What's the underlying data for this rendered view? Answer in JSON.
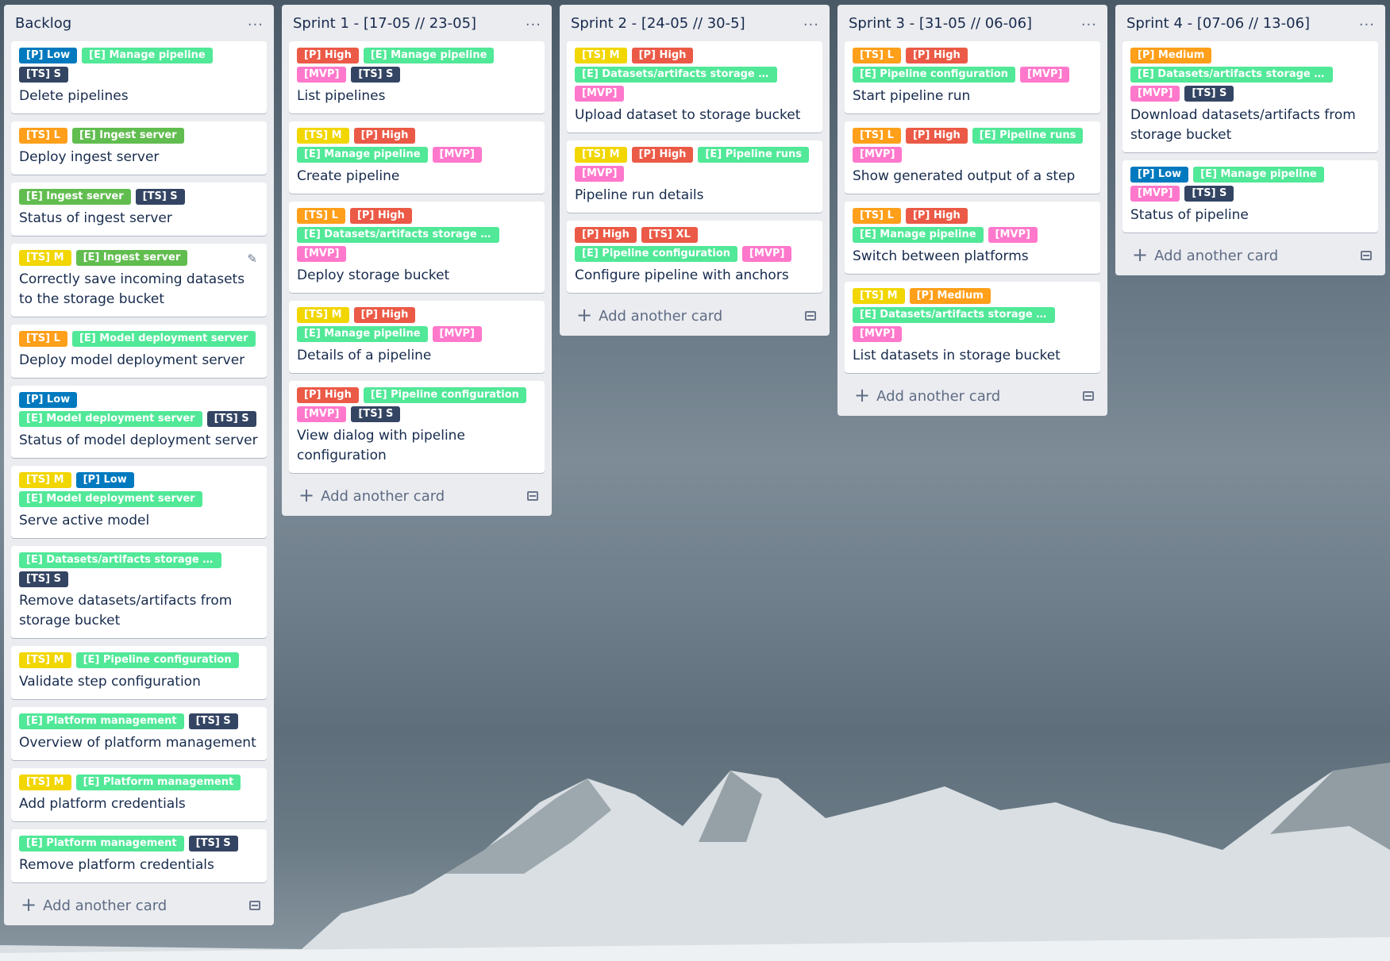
{
  "menu_icon": "...",
  "label_colors": {
    "blue": "#0079bf",
    "green": "#61bd4f",
    "mint": "#51e898",
    "dark": "#344563",
    "yellow": "#f2d600",
    "orange": "#ff9f1a",
    "red": "#eb5a46",
    "pink": "#ff78cb"
  },
  "add_card_label": "Add another card",
  "lists": [
    {
      "title": "Backlog",
      "cards": [
        {
          "labels": [
            {
              "text": "[P] Low",
              "color": "blue"
            },
            {
              "text": "[E] Manage pipeline",
              "color": "mint"
            },
            {
              "text": "[TS] S",
              "color": "dark"
            }
          ],
          "title": "Delete pipelines"
        },
        {
          "labels": [
            {
              "text": "[TS] L",
              "color": "orange"
            },
            {
              "text": "[E] Ingest server",
              "color": "green"
            }
          ],
          "title": "Deploy ingest server"
        },
        {
          "labels": [
            {
              "text": "[E] Ingest server",
              "color": "green"
            },
            {
              "text": "[TS] S",
              "color": "dark"
            }
          ],
          "title": "Status of ingest server"
        },
        {
          "labels": [
            {
              "text": "[TS] M",
              "color": "yellow"
            },
            {
              "text": "[E] Ingest server",
              "color": "green"
            }
          ],
          "title": "Correctly save incoming datasets to the storage bucket",
          "edit": true
        },
        {
          "labels": [
            {
              "text": "[TS] L",
              "color": "orange"
            },
            {
              "text": "[E] Model deployment server",
              "color": "mint"
            }
          ],
          "title": "Deploy model deployment server"
        },
        {
          "labels": [
            {
              "text": "[P] Low",
              "color": "blue"
            },
            {
              "text": "[E] Model deployment server",
              "color": "mint"
            },
            {
              "text": "[TS] S",
              "color": "dark"
            }
          ],
          "title": "Status of model deployment server"
        },
        {
          "labels": [
            {
              "text": "[TS] M",
              "color": "yellow"
            },
            {
              "text": "[P] Low",
              "color": "blue"
            },
            {
              "text": "[E] Model deployment server",
              "color": "mint"
            }
          ],
          "title": "Serve active model"
        },
        {
          "labels": [
            {
              "text": "[E] Datasets/artifacts storage bu...",
              "color": "mint"
            },
            {
              "text": "[TS] S",
              "color": "dark"
            }
          ],
          "title": "Remove datasets/artifacts from storage bucket"
        },
        {
          "labels": [
            {
              "text": "[TS] M",
              "color": "yellow"
            },
            {
              "text": "[E] Pipeline configuration",
              "color": "mint"
            }
          ],
          "title": "Validate step configuration"
        },
        {
          "labels": [
            {
              "text": "[E] Platform management",
              "color": "mint"
            },
            {
              "text": "[TS] S",
              "color": "dark"
            }
          ],
          "title": "Overview of platform management"
        },
        {
          "labels": [
            {
              "text": "[TS] M",
              "color": "yellow"
            },
            {
              "text": "[E] Platform management",
              "color": "mint"
            }
          ],
          "title": "Add platform credentials"
        },
        {
          "labels": [
            {
              "text": "[E] Platform management",
              "color": "mint"
            },
            {
              "text": "[TS] S",
              "color": "dark"
            }
          ],
          "title": "Remove platform credentials"
        }
      ]
    },
    {
      "title": "Sprint 1 - [17-05 // 23-05]",
      "cards": [
        {
          "labels": [
            {
              "text": "[P] High",
              "color": "red"
            },
            {
              "text": "[E] Manage pipeline",
              "color": "mint"
            },
            {
              "text": "[MVP]",
              "color": "pink"
            },
            {
              "text": "[TS] S",
              "color": "dark"
            }
          ],
          "title": "List pipelines"
        },
        {
          "labels": [
            {
              "text": "[TS] M",
              "color": "yellow"
            },
            {
              "text": "[P] High",
              "color": "red"
            },
            {
              "text": "[E] Manage pipeline",
              "color": "mint"
            },
            {
              "text": "[MVP]",
              "color": "pink"
            }
          ],
          "title": "Create pipeline"
        },
        {
          "labels": [
            {
              "text": "[TS] L",
              "color": "orange"
            },
            {
              "text": "[P] High",
              "color": "red"
            },
            {
              "text": "[E] Datasets/artifacts storage bu...",
              "color": "mint"
            },
            {
              "text": "[MVP]",
              "color": "pink"
            }
          ],
          "title": "Deploy storage bucket"
        },
        {
          "labels": [
            {
              "text": "[TS] M",
              "color": "yellow"
            },
            {
              "text": "[P] High",
              "color": "red"
            },
            {
              "text": "[E] Manage pipeline",
              "color": "mint"
            },
            {
              "text": "[MVP]",
              "color": "pink"
            }
          ],
          "title": "Details of a pipeline"
        },
        {
          "labels": [
            {
              "text": "[P] High",
              "color": "red"
            },
            {
              "text": "[E] Pipeline configuration",
              "color": "mint"
            },
            {
              "text": "[MVP]",
              "color": "pink"
            },
            {
              "text": "[TS] S",
              "color": "dark"
            }
          ],
          "title": "View dialog with pipeline configuration"
        }
      ]
    },
    {
      "title": "Sprint 2 - [24-05 // 30-5]",
      "cards": [
        {
          "labels": [
            {
              "text": "[TS] M",
              "color": "yellow"
            },
            {
              "text": "[P] High",
              "color": "red"
            },
            {
              "text": "[E] Datasets/artifacts storage bu...",
              "color": "mint"
            },
            {
              "text": "[MVP]",
              "color": "pink"
            }
          ],
          "title": "Upload dataset to storage bucket"
        },
        {
          "labels": [
            {
              "text": "[TS] M",
              "color": "yellow"
            },
            {
              "text": "[P] High",
              "color": "red"
            },
            {
              "text": "[E] Pipeline runs",
              "color": "mint"
            },
            {
              "text": "[MVP]",
              "color": "pink"
            }
          ],
          "title": "Pipeline run details"
        },
        {
          "labels": [
            {
              "text": "[P] High",
              "color": "red"
            },
            {
              "text": "[TS] XL",
              "color": "red"
            },
            {
              "text": "[E] Pipeline configuration",
              "color": "mint"
            },
            {
              "text": "[MVP]",
              "color": "pink"
            }
          ],
          "title": "Configure pipeline with anchors"
        }
      ]
    },
    {
      "title": "Sprint 3 - [31-05 // 06-06]",
      "cards": [
        {
          "labels": [
            {
              "text": "[TS] L",
              "color": "orange"
            },
            {
              "text": "[P] High",
              "color": "red"
            },
            {
              "text": "[E] Pipeline configuration",
              "color": "mint"
            },
            {
              "text": "[MVP]",
              "color": "pink"
            }
          ],
          "title": "Start pipeline run"
        },
        {
          "labels": [
            {
              "text": "[TS] L",
              "color": "orange"
            },
            {
              "text": "[P] High",
              "color": "red"
            },
            {
              "text": "[E] Pipeline runs",
              "color": "mint"
            },
            {
              "text": "[MVP]",
              "color": "pink"
            }
          ],
          "title": "Show generated output of a step"
        },
        {
          "labels": [
            {
              "text": "[TS] L",
              "color": "orange"
            },
            {
              "text": "[P] High",
              "color": "red"
            },
            {
              "text": "[E] Manage pipeline",
              "color": "mint"
            },
            {
              "text": "[MVP]",
              "color": "pink"
            }
          ],
          "title": "Switch between platforms"
        },
        {
          "labels": [
            {
              "text": "[TS] M",
              "color": "yellow"
            },
            {
              "text": "[P] Medium",
              "color": "orange"
            },
            {
              "text": "[E] Datasets/artifacts storage bu...",
              "color": "mint"
            },
            {
              "text": "[MVP]",
              "color": "pink"
            }
          ],
          "title": "List datasets in storage bucket"
        }
      ]
    },
    {
      "title": "Sprint 4 - [07-06 // 13-06]",
      "cards": [
        {
          "labels": [
            {
              "text": "[P] Medium",
              "color": "orange"
            },
            {
              "text": "[E] Datasets/artifacts storage bu...",
              "color": "mint"
            },
            {
              "text": "[MVP]",
              "color": "pink"
            },
            {
              "text": "[TS] S",
              "color": "dark"
            }
          ],
          "title": "Download datasets/artifacts from storage bucket"
        },
        {
          "labels": [
            {
              "text": "[P] Low",
              "color": "blue"
            },
            {
              "text": "[E] Manage pipeline",
              "color": "mint"
            },
            {
              "text": "[MVP]",
              "color": "pink"
            },
            {
              "text": "[TS] S",
              "color": "dark"
            }
          ],
          "title": "Status of pipeline"
        }
      ]
    }
  ]
}
